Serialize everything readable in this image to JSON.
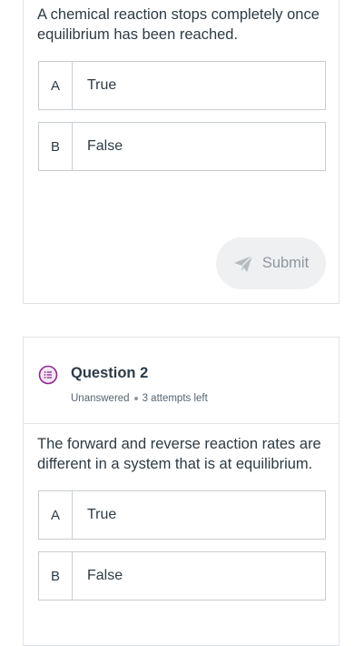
{
  "question1": {
    "prompt": "A chemical reaction stops completely once equilibrium has been reached.",
    "options": [
      {
        "letter": "A",
        "text": "True"
      },
      {
        "letter": "B",
        "text": "False"
      }
    ],
    "submit_label": "Submit",
    "submit_icon": "paper-plane-icon"
  },
  "question2": {
    "title": "Question 2",
    "status": "Unanswered",
    "attempts": "3 attempts left",
    "icon": "question-list-icon",
    "prompt": "The forward and reverse reaction rates are different in a system that is at equilibrium.",
    "options": [
      {
        "letter": "A",
        "text": "True"
      },
      {
        "letter": "B",
        "text": "False"
      }
    ]
  },
  "colors": {
    "text": "#2d3b45",
    "border": "#c7cdd1",
    "icon_accent": "#8e2a8f",
    "submit_bg": "#eef0f2",
    "submit_text": "#8f979d"
  }
}
